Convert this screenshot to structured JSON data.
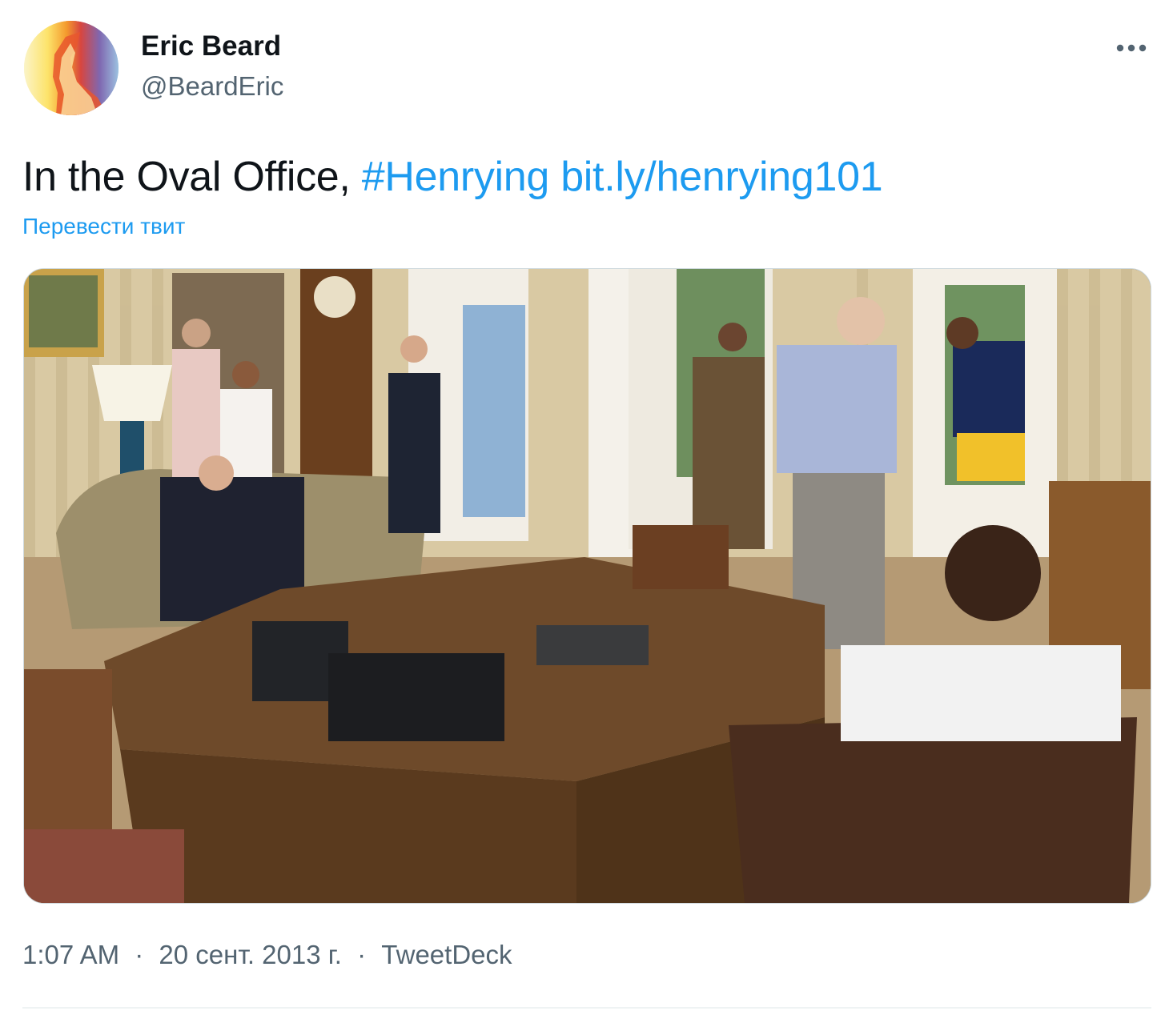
{
  "author": {
    "name": "Eric Beard",
    "handle": "@BeardEric",
    "avatar_icon": "profile-photo"
  },
  "menu": {
    "icon": "more-dots-icon"
  },
  "tweet": {
    "text": "In the Oval Office,",
    "hashtag": "#Henrying",
    "link": "bit.ly/henrying101",
    "translate_label": "Перевести твит"
  },
  "media": {
    "type": "photo",
    "icon": "photo-image"
  },
  "meta": {
    "time": "1:07 AM",
    "separator": "·",
    "date": "20 сент. 2013 г.",
    "source": "TweetDeck"
  },
  "colors": {
    "link": "#1d9bf0",
    "text": "#0f1419",
    "secondary": "#536471",
    "divider": "#eff3f4"
  }
}
